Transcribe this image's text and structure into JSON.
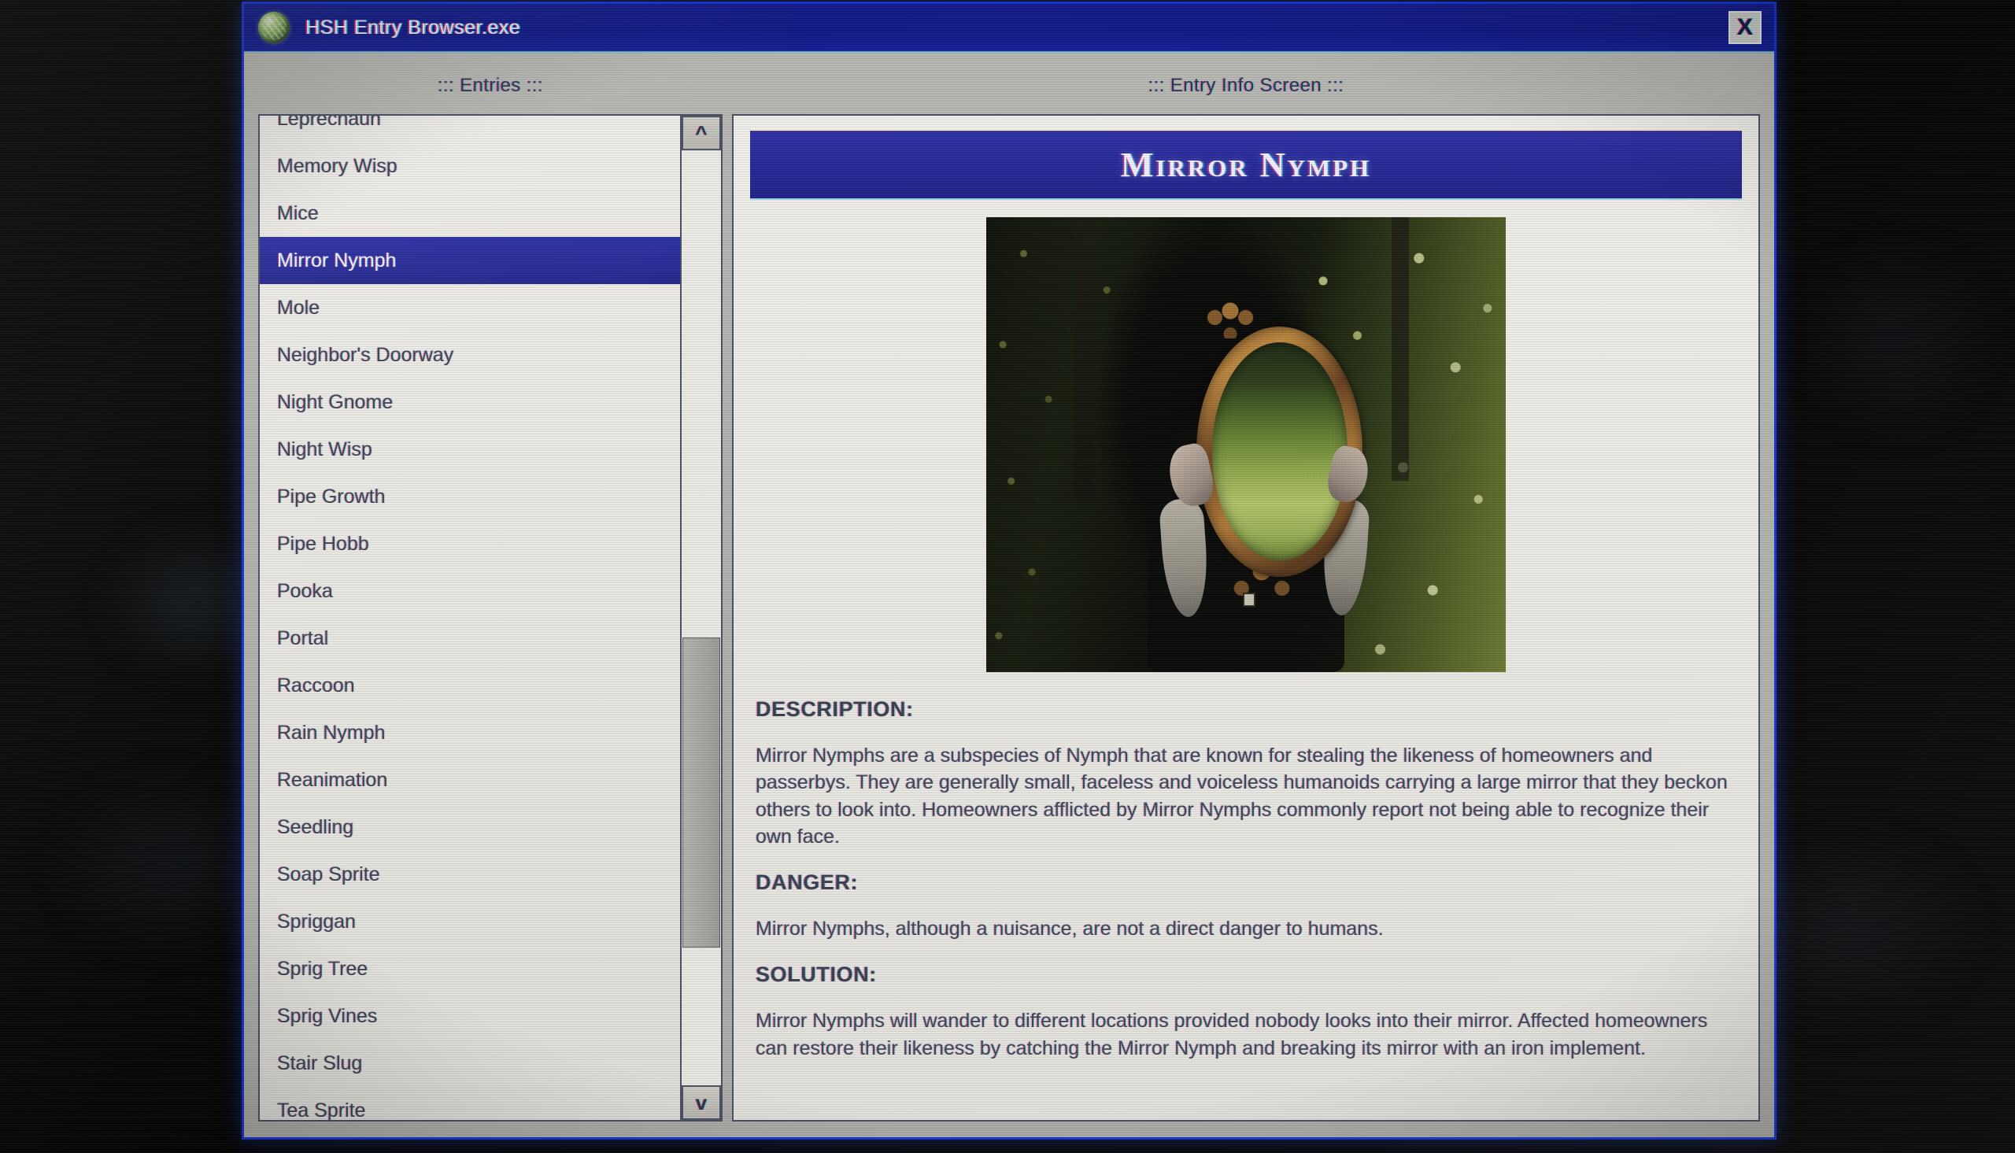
{
  "window": {
    "title": "HSH Entry Browser.exe",
    "icon": "globe-icon",
    "close_label": "X",
    "title_bar_color": "#101a8c",
    "accent_color": "#2b2fa5"
  },
  "entries_pane": {
    "heading": "::: Entries :::",
    "selected": "Mirror Nymph",
    "items": [
      {
        "label": "Leprechaun",
        "selected": false,
        "clipped": true
      },
      {
        "label": "Memory Wisp",
        "selected": false
      },
      {
        "label": "Mice",
        "selected": false
      },
      {
        "label": "Mirror Nymph",
        "selected": true
      },
      {
        "label": "Mole",
        "selected": false
      },
      {
        "label": "Neighbor's Doorway",
        "selected": false
      },
      {
        "label": "Night Gnome",
        "selected": false
      },
      {
        "label": "Night Wisp",
        "selected": false
      },
      {
        "label": "Pipe Growth",
        "selected": false
      },
      {
        "label": "Pipe Hobb",
        "selected": false
      },
      {
        "label": "Pooka",
        "selected": false
      },
      {
        "label": "Portal",
        "selected": false
      },
      {
        "label": "Raccoon",
        "selected": false
      },
      {
        "label": "Rain Nymph",
        "selected": false
      },
      {
        "label": "Reanimation",
        "selected": false
      },
      {
        "label": "Seedling",
        "selected": false
      },
      {
        "label": "Soap Sprite",
        "selected": false
      },
      {
        "label": "Spriggan",
        "selected": false
      },
      {
        "label": "Sprig Tree",
        "selected": false
      },
      {
        "label": "Sprig Vines",
        "selected": false
      },
      {
        "label": "Stair Slug",
        "selected": false
      },
      {
        "label": "Tea Sprite",
        "selected": false,
        "clipped": true
      }
    ],
    "scrollbar": {
      "up_arrow": "^",
      "down_arrow": "v"
    }
  },
  "info_pane": {
    "heading": "::: Entry Info Screen :::",
    "entry_title": "Mirror Nymph",
    "photo_alt": "mirror-nymph-photo",
    "sections": [
      {
        "label": "DESCRIPTION:",
        "body": "Mirror Nymphs are a subspecies of Nymph that are known for stealing the likeness of homeowners and passerbys. They are generally small, faceless and voiceless humanoids carrying a large mirror that they beckon others to look into. Homeowners afflicted by Mirror Nymphs commonly report not being able to recognize their own face."
      },
      {
        "label": "DANGER:",
        "body": "Mirror Nymphs, although a nuisance, are not a direct danger to humans."
      },
      {
        "label": "SOLUTION:",
        "body": "Mirror Nymphs will wander to different locations provided nobody looks into their mirror. Affected homeowners can restore their likeness by catching the Mirror Nymph and breaking its mirror with an iron implement."
      }
    ]
  }
}
